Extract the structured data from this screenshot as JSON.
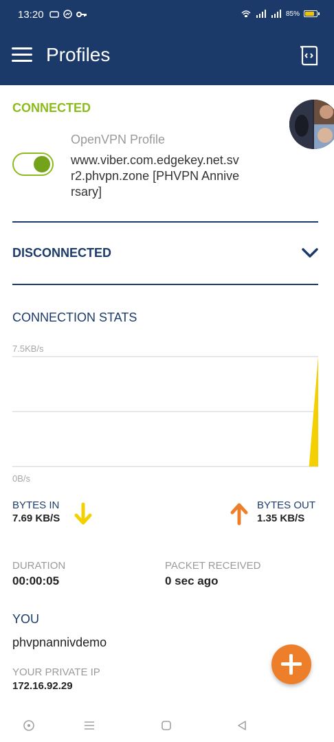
{
  "status_bar": {
    "time": "13:20",
    "battery_percent": "85%",
    "battery_level": 0.85
  },
  "app_bar": {
    "title": "Profiles",
    "menu_icon": "hamburger-menu-icon",
    "action_icon": "import-profile-icon"
  },
  "connected": {
    "label": "CONNECTED",
    "profile_type": "OpenVPN Profile",
    "profile_name": "www.viber.com.edgekey.net.svr2.phvpn.zone [PHVPN Anniversary]",
    "toggle_on": true
  },
  "disconnected": {
    "label": "DISCONNECTED"
  },
  "stats": {
    "label": "CONNECTION STATS",
    "bytes_in_label": "BYTES IN",
    "bytes_in_value": "7.69 KB/S",
    "bytes_out_label": "BYTES OUT",
    "bytes_out_value": "1.35 KB/S",
    "duration_label": "DURATION",
    "duration_value": "00:00:05",
    "packet_label": "PACKET RECEIVED",
    "packet_value": "0 sec ago"
  },
  "you": {
    "label": "YOU",
    "username": "phvpnannivdemo",
    "private_ip_label": "YOUR PRIVATE IP",
    "private_ip_value": "172.16.92.29"
  },
  "chart_data": {
    "type": "area",
    "y_max_label": "7.5KB/s",
    "y_min_label": "0B/s",
    "ylim": [
      0,
      7.5
    ],
    "grid": true,
    "series": [
      {
        "color": "#f4d000",
        "points": [
          [
            0,
            0
          ],
          [
            0.97,
            0
          ],
          [
            1.0,
            7.5
          ]
        ]
      }
    ]
  },
  "colors": {
    "primary": "#1b3a6a",
    "connected": "#8dbb1d",
    "accent": "#ee7f2a",
    "bytes_in": "#f4d000",
    "bytes_out": "#ee7f2a"
  }
}
